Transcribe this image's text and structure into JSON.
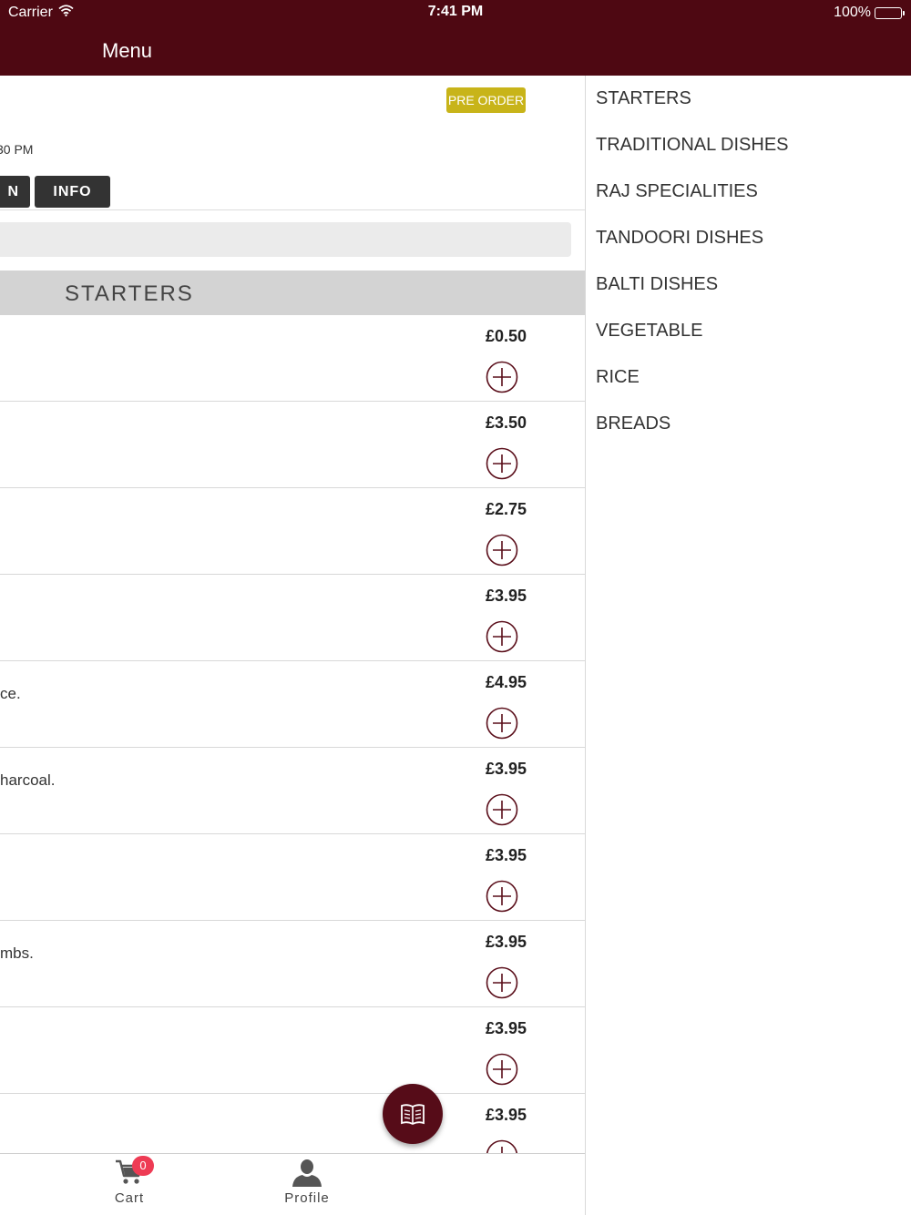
{
  "status_bar": {
    "carrier": "Carrier",
    "time": "7:41 PM",
    "battery": "100%"
  },
  "header": {
    "title": "Menu"
  },
  "left_panel": {
    "preorder_label": "PRE ORDER",
    "hours_text": "30 PM",
    "tabs": [
      {
        "label": "N"
      },
      {
        "label": "INFO"
      }
    ],
    "category_title": "STARTERS",
    "items": [
      {
        "description": "",
        "price": "£0.50"
      },
      {
        "description": "",
        "price": "£3.50"
      },
      {
        "description": "",
        "price": "£2.75"
      },
      {
        "description": "",
        "price": "£3.95"
      },
      {
        "description": "ce.",
        "price": "£4.95"
      },
      {
        "description": "harcoal.",
        "price": "£3.95"
      },
      {
        "description": "",
        "price": "£3.95"
      },
      {
        "description": "mbs.",
        "price": "£3.95"
      },
      {
        "description": "",
        "price": "£3.95"
      },
      {
        "description": "",
        "price": "£3.95"
      }
    ]
  },
  "bottom_bar": {
    "cart_label": "Cart",
    "cart_count": "0",
    "profile_label": "Profile"
  },
  "categories": [
    "STARTERS",
    "TRADITIONAL DISHES",
    "RAJ SPECIALITIES",
    "TANDOORI DISHES",
    "BALTI DISHES",
    "VEGETABLE",
    "RICE",
    "BREADS"
  ],
  "colors": {
    "brand": "#4e0812",
    "preorder": "#c8b419",
    "badge": "#ee3b54"
  },
  "icons": {
    "wifi": "wifi-icon",
    "battery": "battery-icon",
    "add": "plus-circle-icon",
    "menu_book": "book-icon",
    "cart": "cart-icon",
    "profile": "person-icon"
  }
}
